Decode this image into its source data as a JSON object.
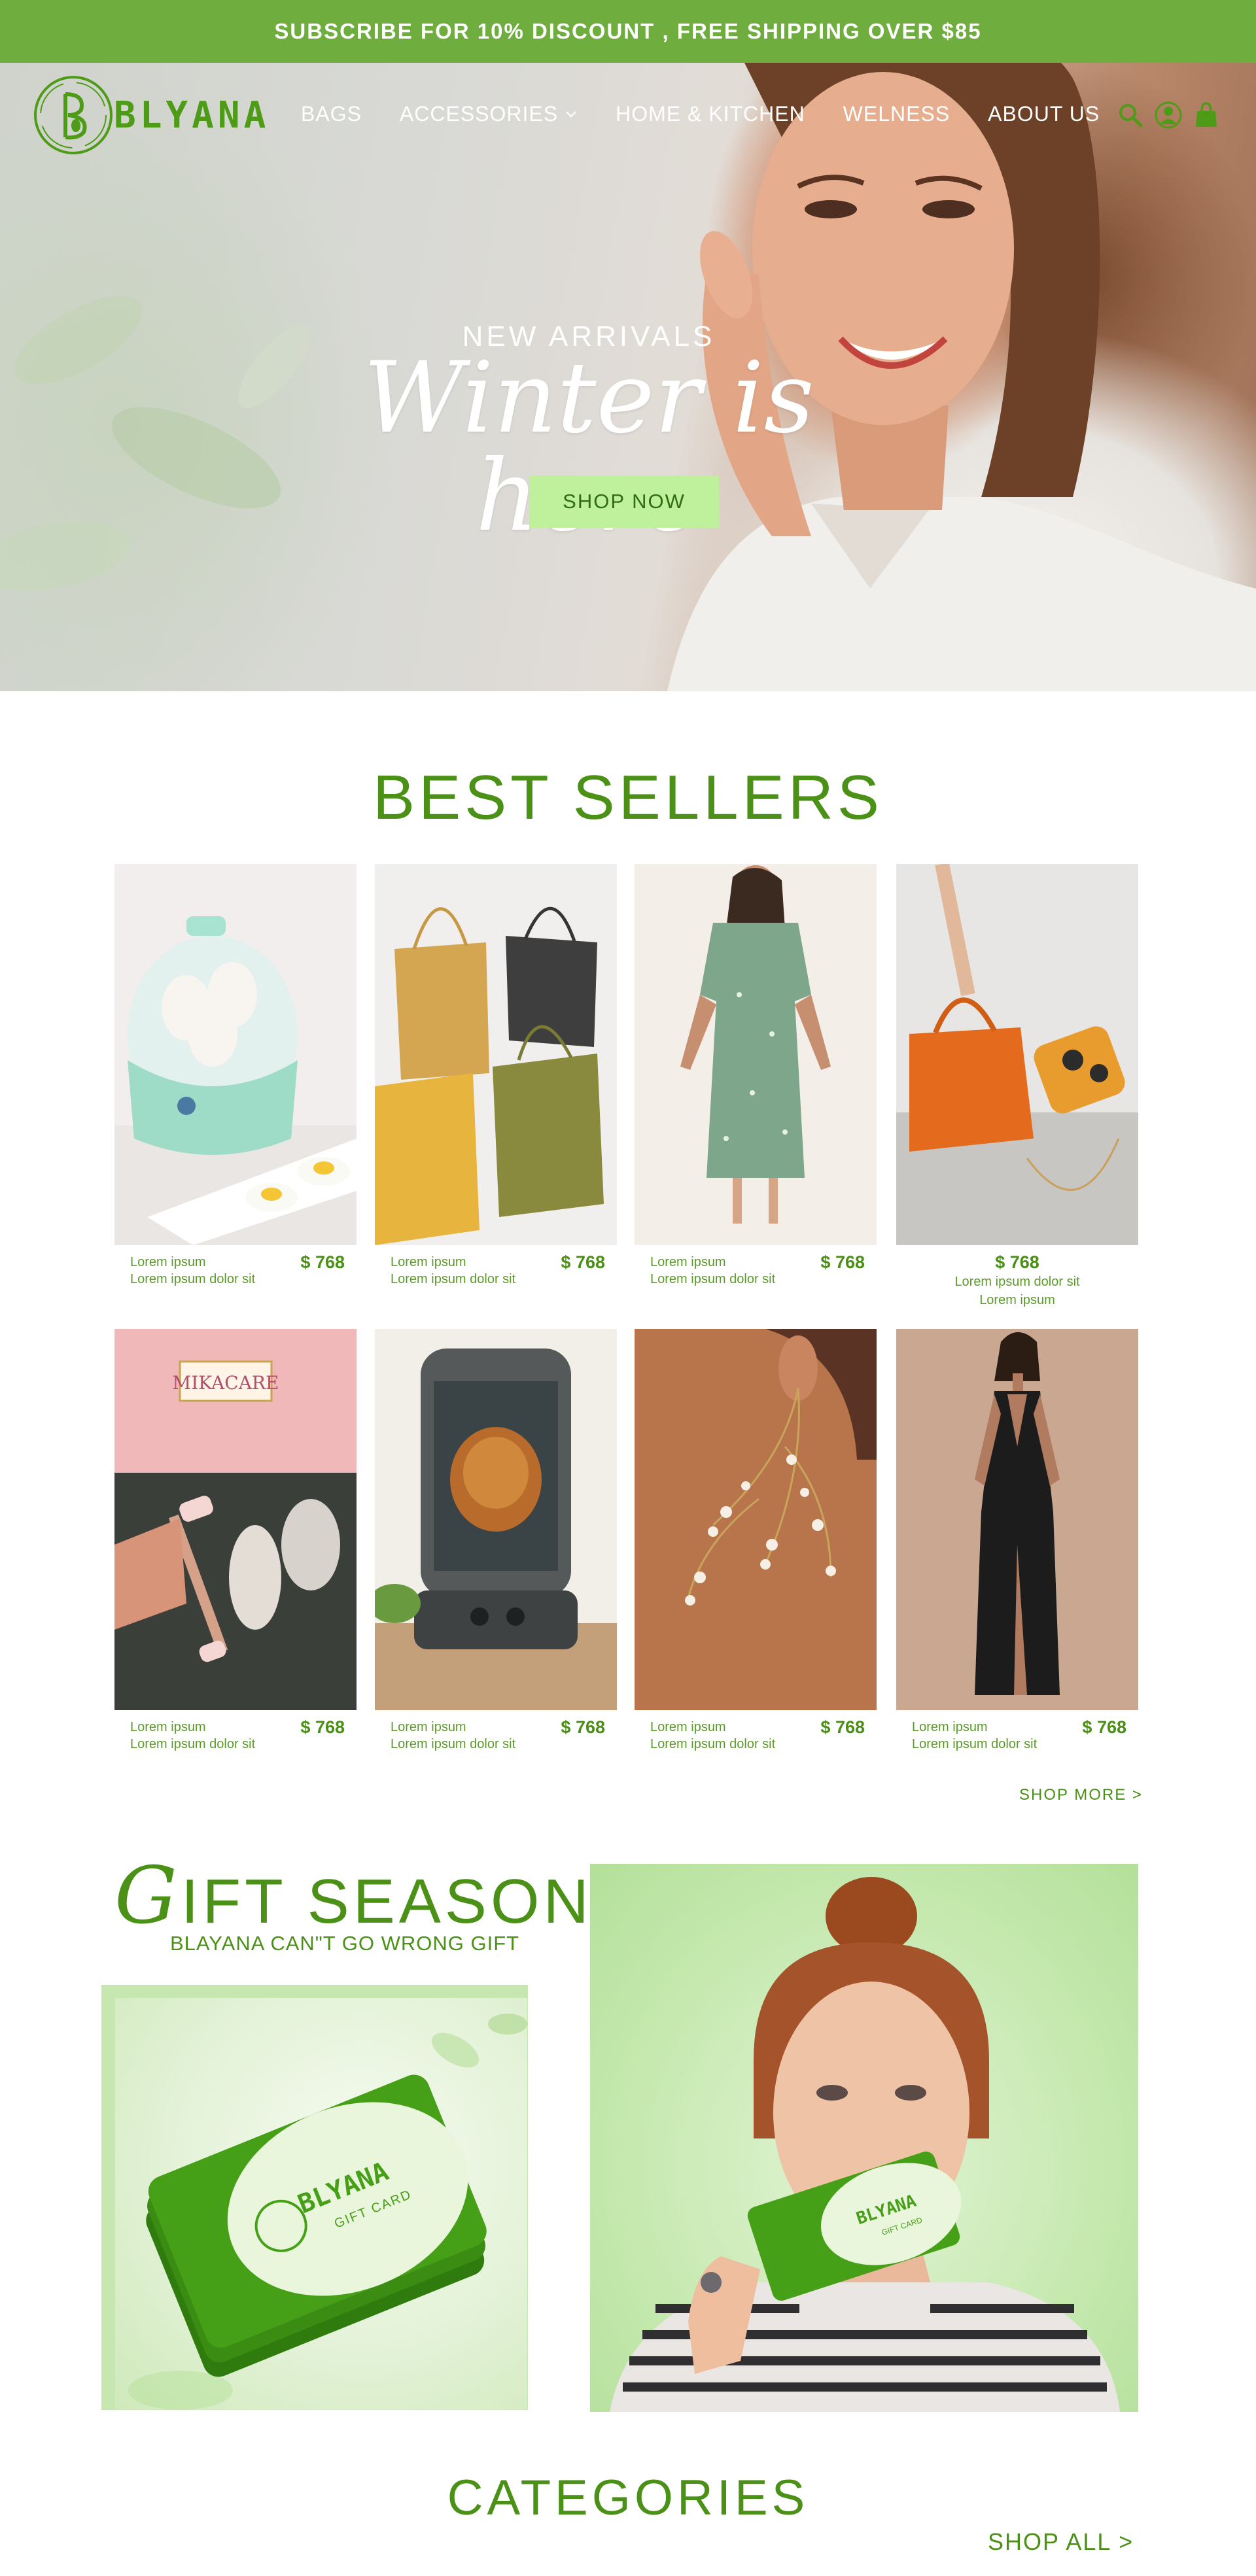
{
  "promo": {
    "text": "SUBSCRIBE FOR 10% DISCOUNT , FREE SHIPPING OVER $85"
  },
  "brand": {
    "name": "BLYANA"
  },
  "nav": {
    "items": [
      {
        "label": "BAGS"
      },
      {
        "label": "ACCESSORIES",
        "has_dropdown": true
      },
      {
        "label": "HOME & KITCHEN"
      },
      {
        "label": "WELNESS"
      },
      {
        "label": "ABOUT US"
      }
    ],
    "icons": [
      "search-icon",
      "user-icon",
      "bag-icon"
    ]
  },
  "hero": {
    "kicker": "NEW ARRIVALS",
    "title": "Winter is here",
    "cta": "SHOP NOW"
  },
  "best_sellers": {
    "title": "BEST SELLERS",
    "products": [
      {
        "name1": "Lorem ipsum",
        "name2": "Lorem ipsum dolor sit",
        "price": "$ 768",
        "image": "egg-cooker"
      },
      {
        "name1": "Lorem ipsum",
        "name2": "Lorem ipsum dolor sit",
        "price": "$ 768",
        "image": "tote-bags"
      },
      {
        "name1": "Lorem ipsum",
        "name2": "Lorem ipsum dolor sit",
        "price": "$ 768",
        "image": "green-floral-dress"
      },
      {
        "name1": "Lorem ipsum",
        "name2": "Lorem ipsum dolor sit",
        "price": "$ 768",
        "image": "orange-handbag"
      },
      {
        "name1": "Lorem ipsum",
        "name2": "Lorem ipsum dolor sit",
        "price": "$ 768",
        "image": "jade-roller"
      },
      {
        "name1": "Lorem ipsum",
        "name2": "Lorem ipsum dolor sit",
        "price": "$ 768",
        "image": "rotisserie"
      },
      {
        "name1": "Lorem ipsum",
        "name2": "Lorem ipsum dolor sit",
        "price": "$ 768",
        "image": "pearl-earrings"
      },
      {
        "name1": "Lorem ipsum",
        "name2": "Lorem ipsum dolor sit",
        "price": "$ 768",
        "image": "black-dress"
      }
    ],
    "shop_more": "SHOP MORE >",
    "box_brand": "MIKACARE"
  },
  "gift": {
    "title_initial": "G",
    "title_rest": "IFT SEASON",
    "subtitle": "BLAYANA CAN\"T GO WRONG GIFT",
    "card_brand": "BLYANA",
    "card_label": "GIFT CARD"
  },
  "categories": {
    "title": "CATEGORIES",
    "shop_all": "SHOP ALL >"
  },
  "colors": {
    "brand_green": "#4b9117",
    "promo_bar": "#6fae3e",
    "cta_bg": "#bff09c",
    "cta_text": "#2f6d10"
  }
}
